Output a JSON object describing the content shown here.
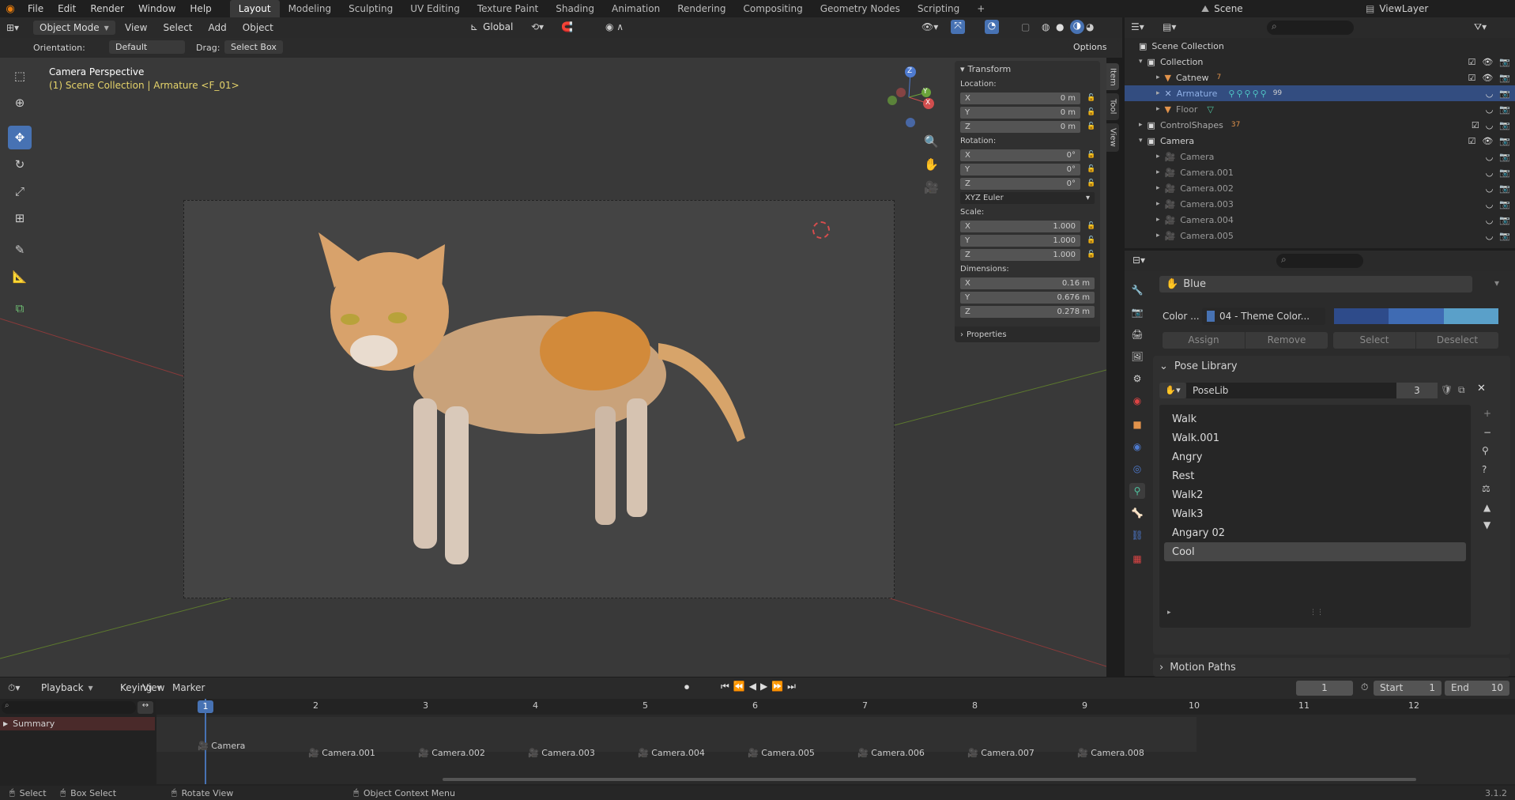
{
  "topbar": {
    "menus": [
      "File",
      "Edit",
      "Render",
      "Window",
      "Help"
    ],
    "workspaces": [
      "Layout",
      "Modeling",
      "Sculpting",
      "UV Editing",
      "Texture Paint",
      "Shading",
      "Animation",
      "Rendering",
      "Compositing",
      "Geometry Nodes",
      "Scripting"
    ],
    "scene": "Scene",
    "viewlayer": "ViewLayer",
    "add_tab": "+"
  },
  "viewport_header": {
    "mode": "Object Mode",
    "menus": [
      "View",
      "Select",
      "Add",
      "Object"
    ],
    "transform_orientation": "Global",
    "orientation_label": "Orientation:",
    "orientation_value": "Default",
    "drag_label": "Drag:",
    "drag_value": "Select Box",
    "options": "Options"
  },
  "viewport": {
    "title": "Camera Perspective",
    "subtitle": "(1) Scene Collection | Armature <F_01>",
    "gizmo": {
      "x": "X",
      "y": "Y",
      "z": "Z"
    }
  },
  "npanel": {
    "title": "Transform",
    "location": "Location:",
    "rotation": "Rotation:",
    "scale": "Scale:",
    "dimensions": "Dimensions:",
    "mode": "XYZ Euler",
    "properties": "Properties",
    "loc": [
      {
        "a": "X",
        "v": "0 m"
      },
      {
        "a": "Y",
        "v": "0 m"
      },
      {
        "a": "Z",
        "v": "0 m"
      }
    ],
    "rot": [
      {
        "a": "X",
        "v": "0°"
      },
      {
        "a": "Y",
        "v": "0°"
      },
      {
        "a": "Z",
        "v": "0°"
      }
    ],
    "scl": [
      {
        "a": "X",
        "v": "1.000"
      },
      {
        "a": "Y",
        "v": "1.000"
      },
      {
        "a": "Z",
        "v": "1.000"
      }
    ],
    "dim": [
      {
        "a": "X",
        "v": "0.16 m"
      },
      {
        "a": "Y",
        "v": "0.676 m"
      },
      {
        "a": "Z",
        "v": "0.278 m"
      }
    ],
    "tabs": [
      "Item",
      "Tool",
      "View"
    ]
  },
  "outliner": {
    "rows": [
      {
        "label": "Scene Collection",
        "indent": 0,
        "badge": ""
      },
      {
        "label": "Collection",
        "indent": 1,
        "badge": ""
      },
      {
        "label": "Catnew",
        "indent": 2,
        "badge": "7"
      },
      {
        "label": "Armature",
        "indent": 2,
        "badge": "99"
      },
      {
        "label": "Floor",
        "indent": 2,
        "badge": ""
      },
      {
        "label": "ControlShapes",
        "indent": 1,
        "badge": "37"
      },
      {
        "label": "Camera",
        "indent": 1,
        "badge": ""
      },
      {
        "label": "Camera",
        "indent": 2,
        "badge": ""
      },
      {
        "label": "Camera.001",
        "indent": 2,
        "badge": ""
      },
      {
        "label": "Camera.002",
        "indent": 2,
        "badge": ""
      },
      {
        "label": "Camera.003",
        "indent": 2,
        "badge": ""
      },
      {
        "label": "Camera.004",
        "indent": 2,
        "badge": ""
      },
      {
        "label": "Camera.005",
        "indent": 2,
        "badge": ""
      }
    ]
  },
  "props": {
    "bone_group": "Blue",
    "color_label": "Color ...",
    "color_set": "04 - Theme Color...",
    "assign": "Assign",
    "remove": "Remove",
    "select": "Select",
    "deselect": "Deselect",
    "pose_library": "Pose Library",
    "poselib": "PoseLib",
    "users": "3",
    "motion_paths": "Motion Paths",
    "poses": [
      "Walk",
      "Walk.001",
      "Angry",
      "Rest",
      "Walk2",
      "Walk3",
      "Angary 02",
      "Cool"
    ]
  },
  "timeline": {
    "menus": [
      "Playback",
      "Keying",
      "View",
      "Marker"
    ],
    "current_frame": "1",
    "start_label": "Start",
    "start": "1",
    "end_label": "End",
    "end": "10",
    "summary": "Summary",
    "ticks": [
      "1",
      "2",
      "3",
      "4",
      "5",
      "6",
      "7",
      "8",
      "9",
      "10",
      "11",
      "12"
    ],
    "markers": [
      "Camera",
      "Camera.001",
      "Camera.002",
      "Camera.003",
      "Camera.004",
      "Camera.005",
      "Camera.006",
      "Camera.007",
      "Camera.008"
    ]
  },
  "status": {
    "select": "Select",
    "box_select": "Box Select",
    "rotate": "Rotate View",
    "context": "Object Context Menu",
    "version": "3.1.2"
  }
}
